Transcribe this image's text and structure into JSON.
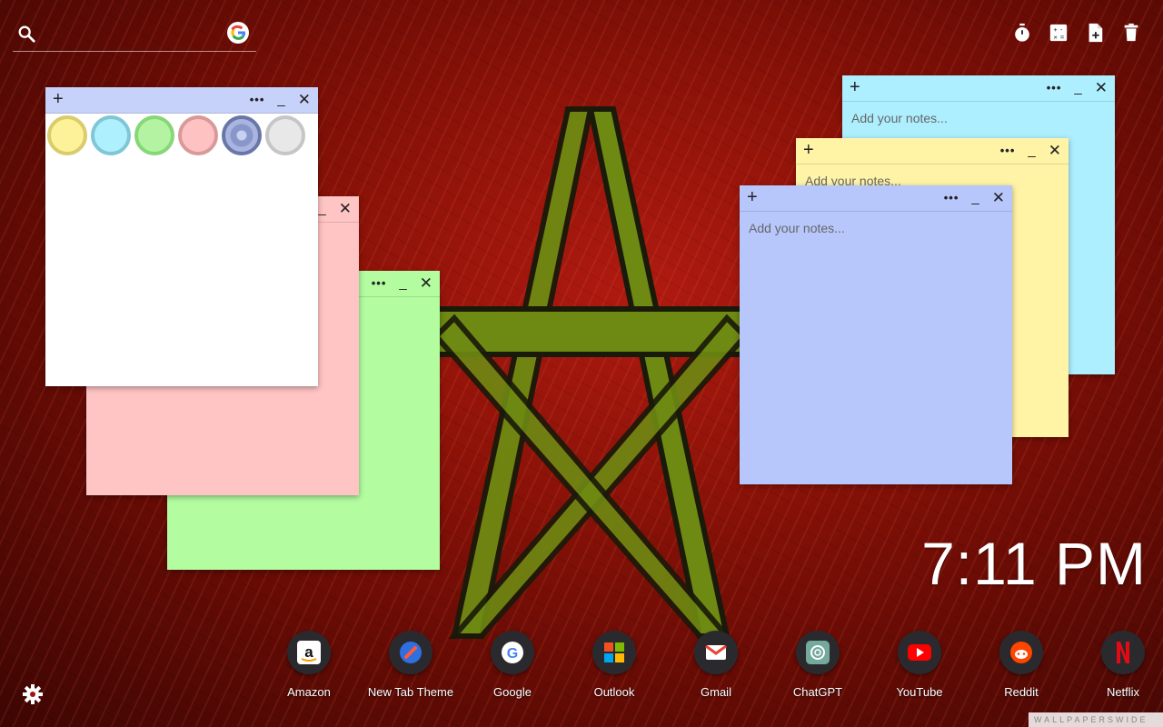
{
  "search": {
    "placeholder": ""
  },
  "top_tools": [
    {
      "name": "timer-icon"
    },
    {
      "name": "calculator-icon"
    },
    {
      "name": "new-note-icon"
    },
    {
      "name": "trash-icon"
    }
  ],
  "notes": {
    "placeholder": "Add your notes...",
    "add_label": "+",
    "more_label": "•••",
    "min_label": "_",
    "close_label": "✕"
  },
  "note_colors": {
    "white": "#ffffff",
    "pink": "#ffc4c4",
    "green": "#b3fca0",
    "cyan": "#adefff",
    "yellow": "#fff3a6",
    "blue": "#b8c7fb",
    "header_white": "#c7d2fa"
  },
  "color_swatches": [
    {
      "name": "yellow",
      "color": "#fdf19a",
      "border": "#d9cc6b"
    },
    {
      "name": "cyan",
      "color": "#aef0fd",
      "border": "#7fc7d6"
    },
    {
      "name": "green",
      "color": "#b3f3a2",
      "border": "#86d777"
    },
    {
      "name": "pink",
      "color": "#ffc2c2",
      "border": "#d99999"
    },
    {
      "name": "blue",
      "color": "#8896c9",
      "border": "#6977a8"
    },
    {
      "name": "gray",
      "color": "#e8e8e8",
      "border": "#c6c6c6"
    }
  ],
  "clock": {
    "time": "7:11 PM"
  },
  "dock": [
    {
      "label": "Amazon",
      "icon": "amazon-icon"
    },
    {
      "label": "New Tab Theme",
      "icon": "new-tab-theme-icon"
    },
    {
      "label": "Google",
      "icon": "google-icon"
    },
    {
      "label": "Outlook",
      "icon": "outlook-icon"
    },
    {
      "label": "Gmail",
      "icon": "gmail-icon"
    },
    {
      "label": "ChatGPT",
      "icon": "chatgpt-icon"
    },
    {
      "label": "YouTube",
      "icon": "youtube-icon"
    },
    {
      "label": "Reddit",
      "icon": "reddit-icon"
    },
    {
      "label": "Netflix",
      "icon": "netflix-icon"
    }
  ],
  "watermark": "WALLPAPERSWIDE"
}
